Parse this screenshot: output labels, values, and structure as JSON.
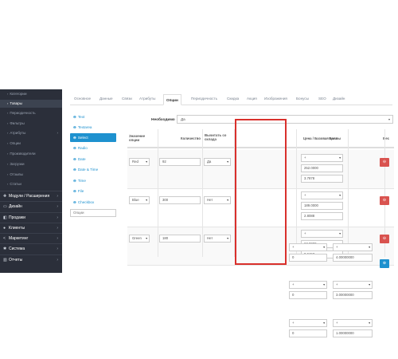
{
  "sidebar": {
    "sub_items": [
      {
        "label": "Категории",
        "active": false
      },
      {
        "label": "Товары",
        "active": true
      },
      {
        "label": "Периодичность",
        "active": false
      },
      {
        "label": "Фильтры",
        "active": false
      },
      {
        "label": "Атрибуты",
        "active": false
      },
      {
        "label": "Опции",
        "active": false
      },
      {
        "label": "Производители",
        "active": false
      },
      {
        "label": "Загрузки",
        "active": false
      },
      {
        "label": "Отзывы",
        "active": false
      },
      {
        "label": "Статьи",
        "active": false
      }
    ],
    "main_items": [
      {
        "label": "Модули / Расширения",
        "icon": "puzzle-icon"
      },
      {
        "label": "Дизайн",
        "icon": "monitor-icon"
      },
      {
        "label": "Продажи",
        "icon": "cart-icon"
      },
      {
        "label": "Клиенты",
        "icon": "user-icon"
      },
      {
        "label": "Маркетинг",
        "icon": "share-icon"
      },
      {
        "label": "Система",
        "icon": "gear-icon"
      },
      {
        "label": "Отчеты",
        "icon": "chart-icon"
      }
    ]
  },
  "tabs": [
    "Основное",
    "Данные",
    "Связи",
    "Атрибуты",
    "Опции",
    "Периодичность",
    "Скидка",
    "Акция",
    "Изображения",
    "Бонусы",
    "SEO",
    "Дизайн"
  ],
  "active_tab": "Опции",
  "option_types": [
    {
      "label": "Text",
      "active": false
    },
    {
      "label": "Textarea",
      "active": false
    },
    {
      "label": "Select",
      "active": true
    },
    {
      "label": "Radio",
      "active": false
    },
    {
      "label": "Date",
      "active": false
    },
    {
      "label": "Date & Time",
      "active": false
    },
    {
      "label": "Time",
      "active": false
    },
    {
      "label": "File",
      "active": false
    },
    {
      "label": "Checkbox",
      "active": false
    }
  ],
  "option_input_placeholder": "Опции",
  "required": {
    "label": "Необходимо",
    "value": "Да"
  },
  "table": {
    "headers": {
      "value": "Значение опции",
      "quantity": "Количество",
      "subtract": "Вычитать со склада",
      "price": "Цена / Базовая цена",
      "points": "Баллы",
      "weight": "Вес"
    },
    "rows": [
      {
        "value": "Red",
        "quantity": "92",
        "subtract": "Да",
        "price_prefix": "+",
        "price": "252.0000",
        "base_price": "3.7878",
        "points_prefix": "+",
        "points": "0",
        "weight_prefix": "+",
        "weight": "4.00000000"
      },
      {
        "value": "Blue",
        "quantity": "300",
        "subtract": "Нет",
        "price_prefix": "+",
        "price": "189.0000",
        "base_price": "2.8088",
        "points_prefix": "+",
        "points": "0",
        "weight_prefix": "+",
        "weight": "3.00000000"
      },
      {
        "value": "Green",
        "quantity": "180",
        "subtract": "Нет",
        "price_prefix": "+",
        "price": "63.0000",
        "base_price": "0.9463",
        "points_prefix": "+",
        "points": "0",
        "weight_prefix": "+",
        "weight": "1.00000000"
      }
    ]
  },
  "colors": {
    "sidebar_bg": "#2b2f3a",
    "accent_blue": "#1e91cf",
    "delete_red": "#d9534f",
    "highlight_red": "#d9302c"
  }
}
